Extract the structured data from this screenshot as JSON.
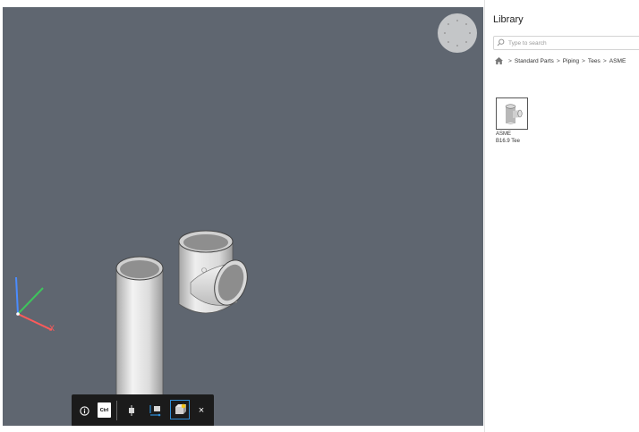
{
  "library": {
    "title": "Library",
    "search_placeholder": "Type to search",
    "breadcrumb": [
      "Standard Parts",
      "Piping",
      "Tees",
      "ASME"
    ],
    "breadcrumb_separator": ">",
    "home_icon": "home-icon",
    "items": [
      {
        "label_line1": "ASME",
        "label_line2": "B16.9 Tee",
        "icon": "tee-fitting-icon"
      }
    ]
  },
  "viewport": {
    "background_color": "#5f6670",
    "nav_cube_icon": "view-navigation-cube",
    "axes": {
      "x_color": "#ff5a5a",
      "y_color": "#3ec45c",
      "z_color": "#4a8cff",
      "x_label": "X"
    }
  },
  "toolbar": {
    "info_icon": "info-icon",
    "ctrl_label": "Ctrl",
    "close_label": "×",
    "tools": [
      "insert-point-icon",
      "align-axis-icon",
      "insert-part-icon"
    ],
    "active_tool": "insert-part-icon",
    "active_color": "#2f8fd8"
  }
}
